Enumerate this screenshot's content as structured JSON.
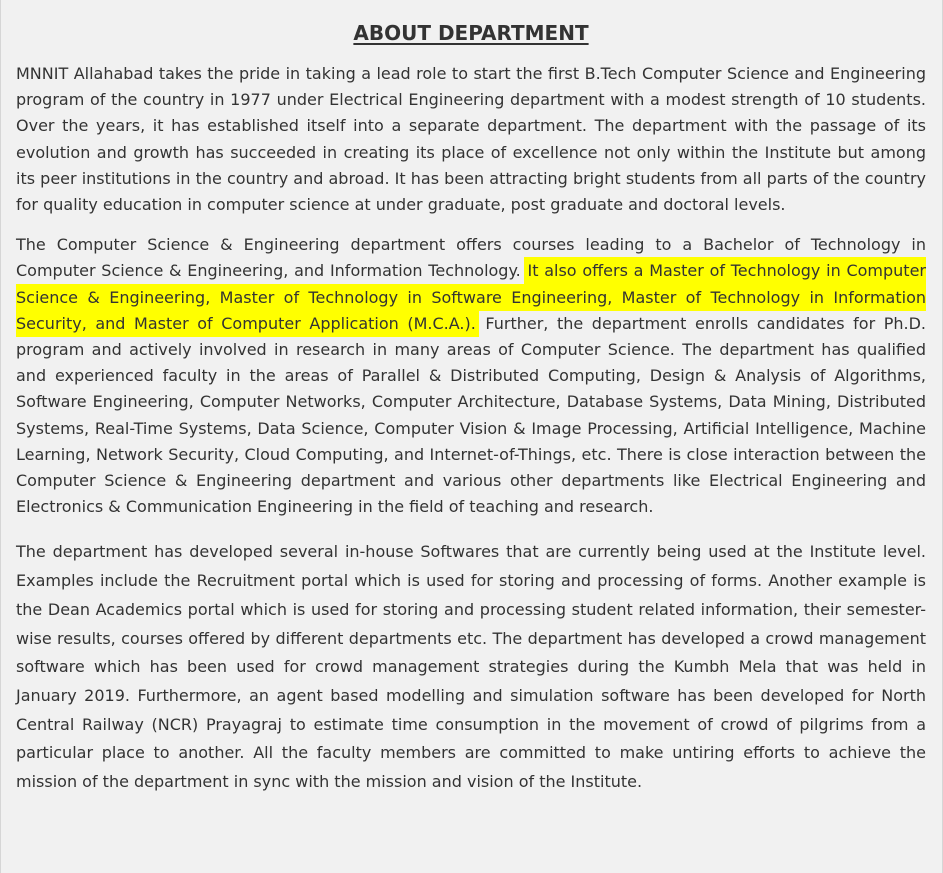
{
  "heading": "ABOUT DEPARTMENT",
  "paragraphs": {
    "p1": "MNNIT Allahabad takes the pride in taking a lead role to start the first B.Tech Computer Science and Engineering program of the country in 1977 under Electrical Engineering department with a modest strength of 10 students. Over the years, it has established itself into a separate department. The department with the passage of its evolution and growth has succeeded in creating its place of excellence not only within the Institute but among its peer institutions in the country and abroad. It has been attracting bright students from all parts of the country for quality education in computer science at under graduate, post graduate and doctoral levels.",
    "p2_before": "The Computer Science & Engineering department offers courses leading to a Bachelor of Technology in Computer Science & Engineering, and Information Technology. ",
    "p2_highlight": "It also offers a Master of Technology in Computer Science & Engineering, Master of Technology in Software Engineering, Master of Technology in Information Security, and Master of Computer Application (M.C.A.).",
    "p2_after": " Further, the department enrolls candidates for Ph.D. program and actively involved in research in many areas of Computer Science. The department has qualified and experienced faculty in the areas of Parallel & Distributed Computing, Design & Analysis of Algorithms, Software Engineering, Computer Networks, Computer Architecture, Database Systems, Data Mining, Distributed Systems, Real-Time Systems, Data Science, Computer Vision & Image Processing, Artificial Intelligence, Machine Learning, Network Security, Cloud Computing, and Internet-of-Things, etc. There is close interaction between the Computer Science & Engineering department and various other departments like Electrical Engineering and Electronics & Communication Engineering in the field of teaching and research.",
    "p3": "The department has developed several in-house Softwares that are currently being used at the Institute level. Examples include the Recruitment portal which is used for storing and processing of forms. Another example is the Dean Academics portal which is used for storing and processing student related information, their semester-wise results, courses offered by different departments etc. The department has developed a crowd management software which has been used for crowd management strategies during the Kumbh Mela that was held in January 2019. Furthermore, an agent based modelling and simulation software has been developed for North Central Railway (NCR) Prayagraj to estimate time consumption in the movement of crowd of pilgrims from a particular place to another. All the faculty members are committed to make untiring efforts to achieve the mission of the department in sync with the mission and vision of the Institute."
  },
  "colors": {
    "background": "#f1f1f1",
    "text": "#333333",
    "highlight": "#ffff00"
  }
}
